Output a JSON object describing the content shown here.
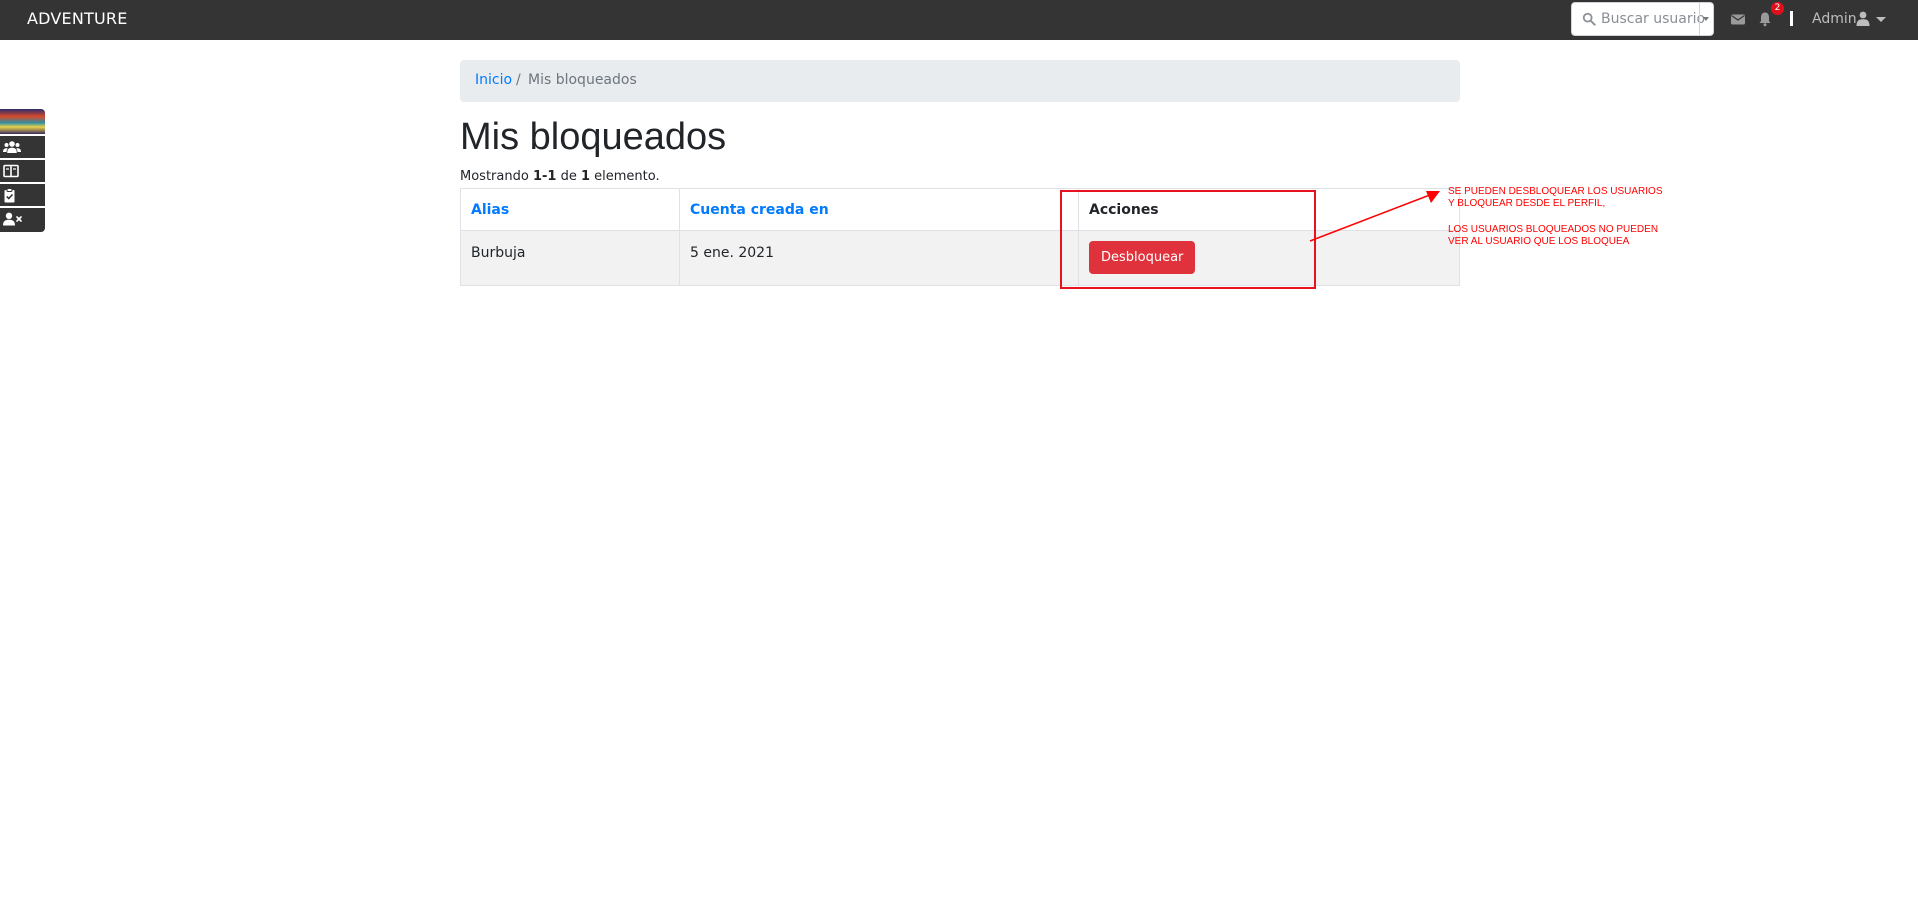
{
  "navbar": {
    "brand": "ADVENTURE",
    "search_placeholder": "Buscar usuario",
    "notification_count": "2",
    "user_label": "Admin"
  },
  "sidebar": {
    "items": [
      {
        "icon": "banner-image"
      },
      {
        "icon": "users-icon"
      },
      {
        "icon": "book-open-icon"
      },
      {
        "icon": "clipboard-check-icon"
      },
      {
        "icon": "user-times-icon"
      }
    ]
  },
  "breadcrumb": {
    "home": "Inicio",
    "separator": "/",
    "current": "Mis bloqueados"
  },
  "page": {
    "title": "Mis bloqueados",
    "summary_prefix": "Mostrando ",
    "summary_range": "1-1",
    "summary_of": " de ",
    "summary_total": "1",
    "summary_suffix": " elemento."
  },
  "table": {
    "headers": [
      "Alias",
      "Cuenta creada en",
      "Acciones"
    ],
    "rows": [
      {
        "alias": "Burbuja",
        "created": "5 ene. 2021",
        "action_label": "Desbloquear"
      }
    ]
  },
  "annotation": {
    "line1": "SE PUEDEN DESBLOQUEAR LOS USUARIOS",
    "line2": "Y BLOQUEAR DESDE EL PERFIL,",
    "line3": "LOS USUARIOS BLOQUEADOS NO PUEDEN",
    "line4": "VER AL USUARIO QUE LOS BLOQUEA",
    "color": "#ff0000"
  },
  "colors": {
    "navbar": "#343434",
    "link": "#007bff",
    "danger": "#e0323c",
    "breadcrumb_bg": "#e9ecef"
  }
}
